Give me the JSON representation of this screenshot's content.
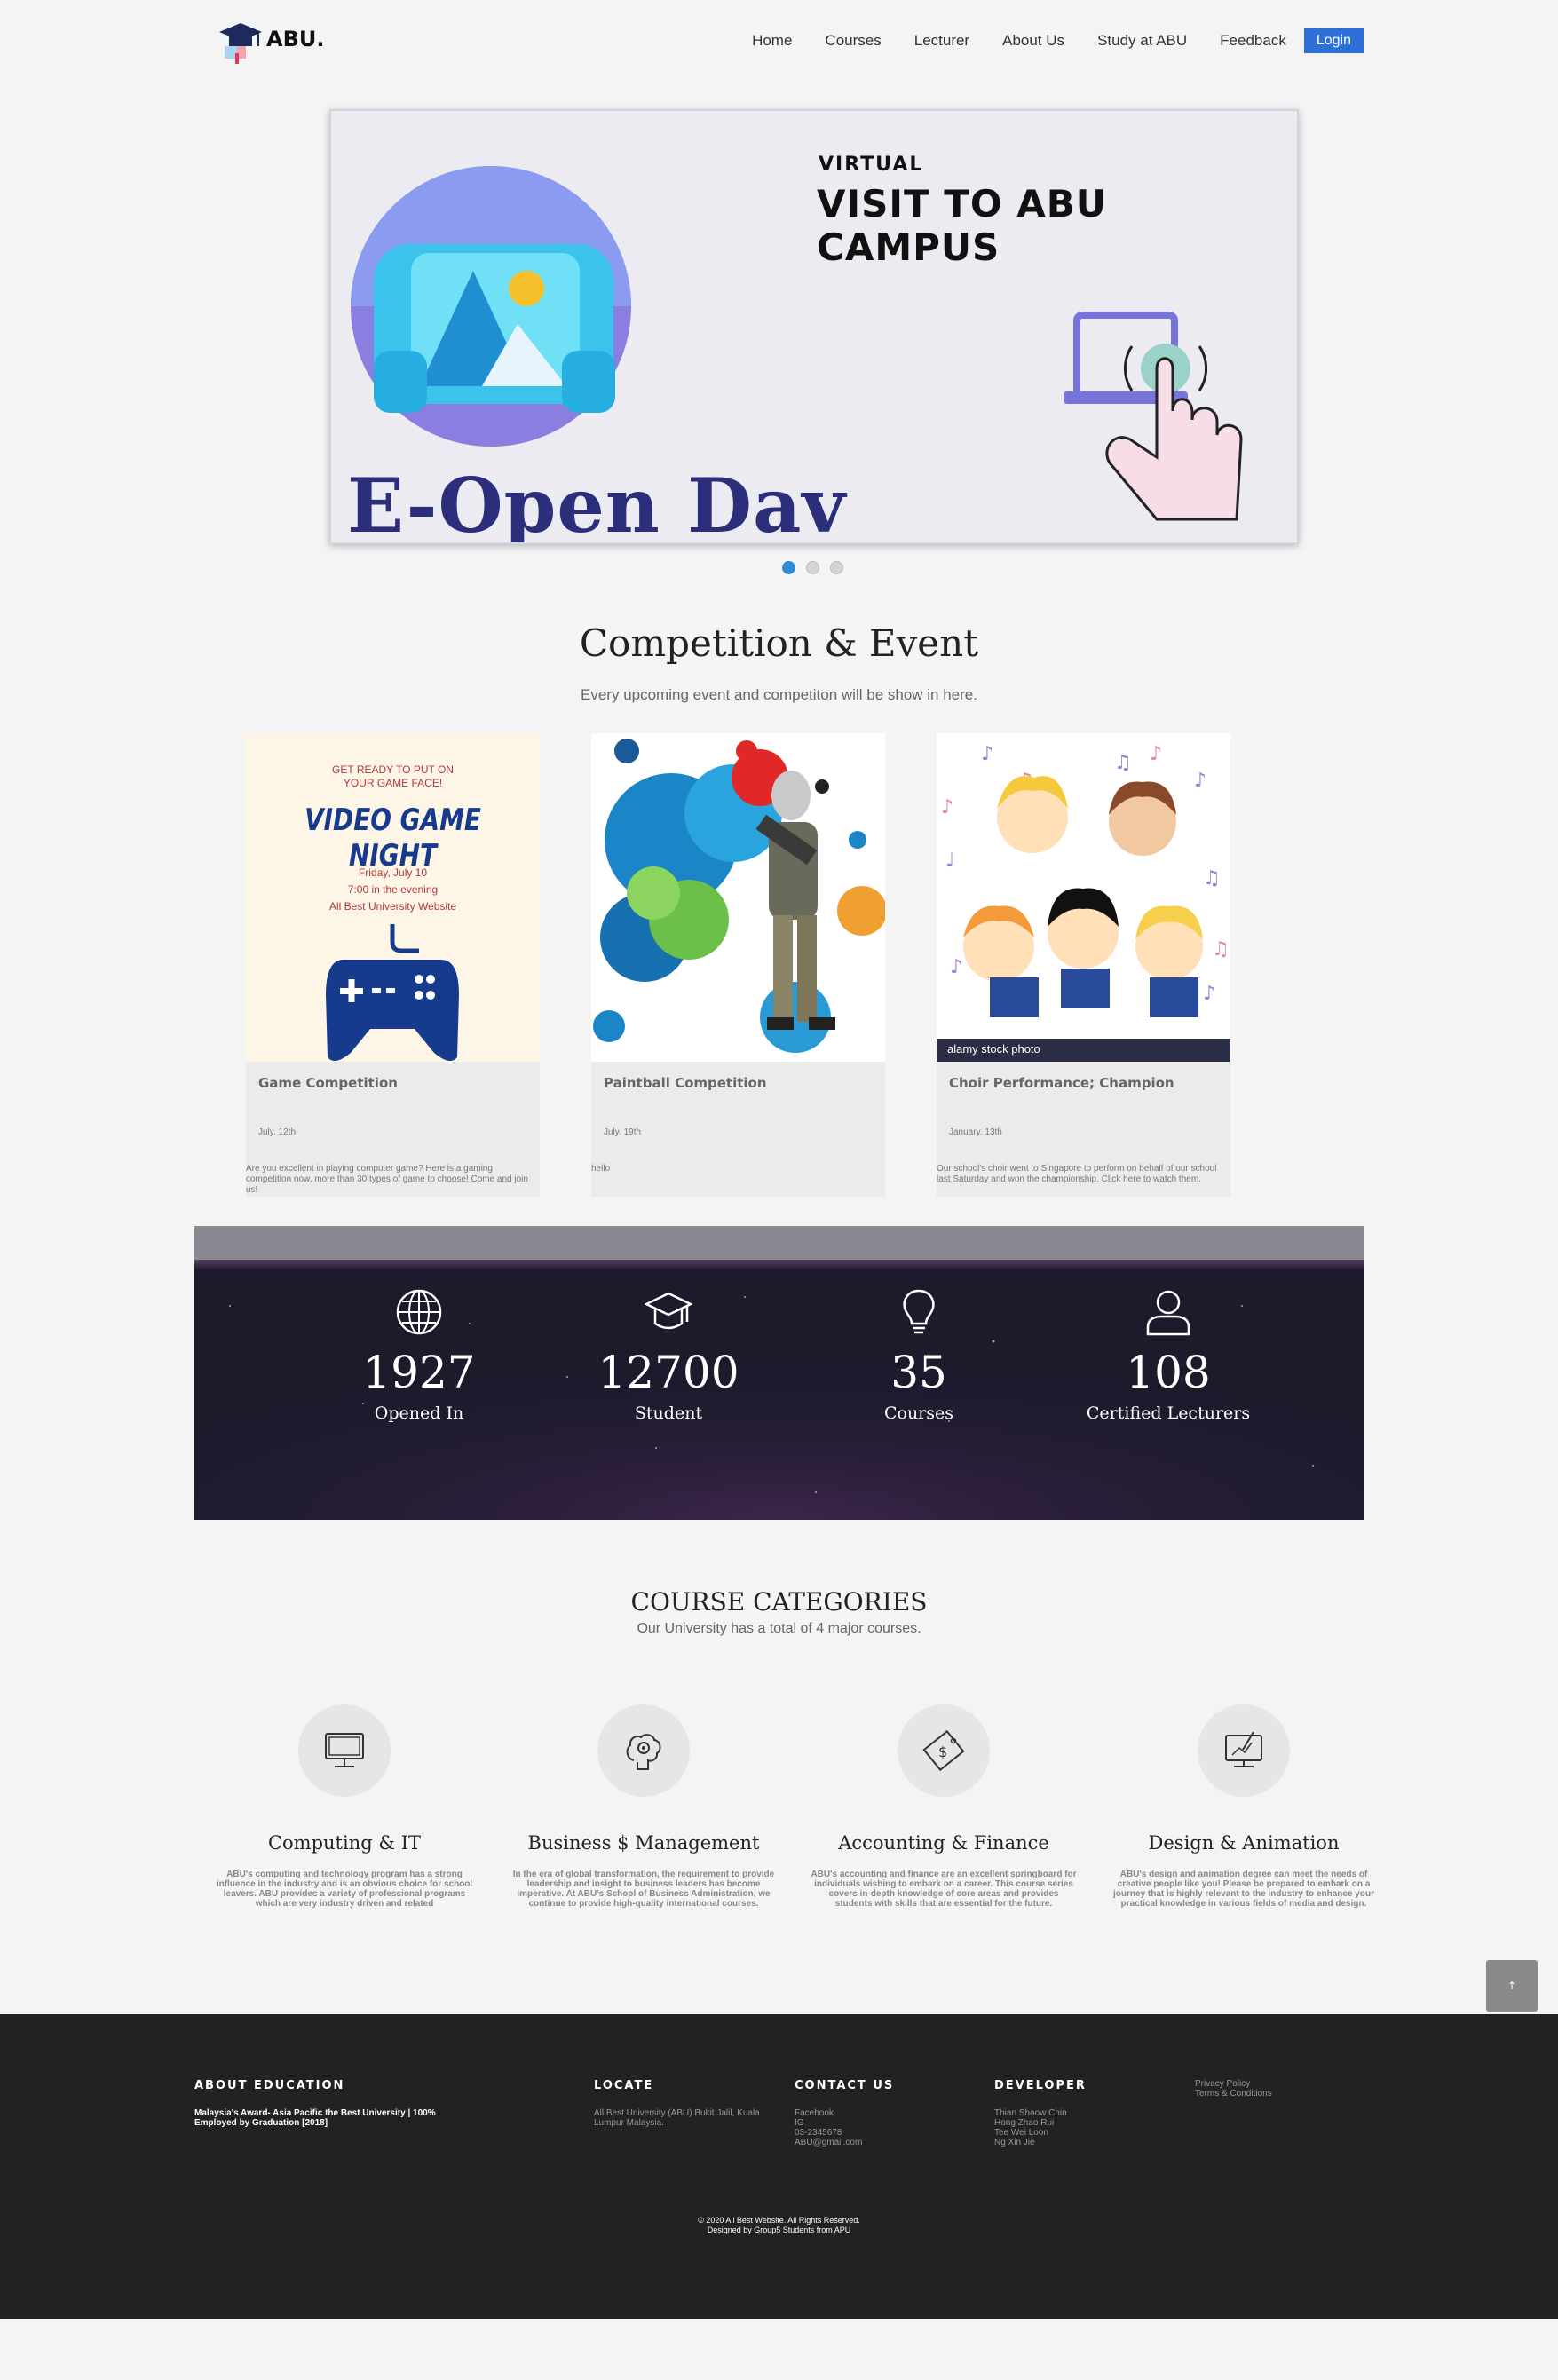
{
  "nav": {
    "brand": "ABU.",
    "items": [
      "Home",
      "Courses",
      "Lecturer",
      "About Us",
      "Study at ABU",
      "Feedback"
    ],
    "login": "Login"
  },
  "hero": {
    "eyebrow": "VIRTUAL",
    "title": "VISIT TO ABU CAMPUS",
    "banner": "E-Open Dav",
    "slides": 3,
    "active_slide": 1
  },
  "events": {
    "title": "Competition & Event",
    "subtitle": "Every upcoming event and competiton will be show in here.",
    "cards": [
      {
        "poster_top": "GET READY TO PUT ON\nYOUR GAME FACE!",
        "poster_title": "VIDEO GAME NIGHT",
        "poster_date": "Friday, July 10",
        "poster_time": "7:00 in the evening",
        "poster_place": "All Best University Website",
        "title": "Game Competition",
        "date": "July. 12th",
        "desc": "Are you excellent in playing computer game? Here is a gaming competition now, more than 30 types of game to choose! Come and join us!"
      },
      {
        "title": "Paintball Competition",
        "date": "July. 19th",
        "desc": "hello"
      },
      {
        "watermark": "alamy stock photo",
        "title": "Choir Performance; Champion",
        "date": "January. 13th",
        "desc": "Our school's choir went to Singapore to perform on behalf of our school last Saturday and won the championship. Click here to watch them."
      }
    ]
  },
  "stats": [
    {
      "icon": "globe-icon",
      "value": "1927",
      "label": "Opened In"
    },
    {
      "icon": "graduation-cap-icon",
      "value": "12700",
      "label": "Student"
    },
    {
      "icon": "lightbulb-icon",
      "value": "35",
      "label": "Courses"
    },
    {
      "icon": "user-icon",
      "value": "108",
      "label": "Certified Lecturers"
    }
  ],
  "courses": {
    "title": "COURSE CATEGORIES",
    "subtitle": "Our University has a total of 4 major courses.",
    "items": [
      {
        "icon": "monitor-icon",
        "name": "Computing & IT",
        "desc": "ABU's computing and technology program has a strong influence in the industry and is an obvious choice for school leavers. ABU provides a variety of professional programs which are very industry driven and related"
      },
      {
        "icon": "brain-gear-icon",
        "name": "Business $ Management",
        "desc": "In the era of global transformation, the requirement to provide leadership and insight to business leaders has become imperative. At ABU's School of Business Administration, we continue to provide high-quality international courses."
      },
      {
        "icon": "money-tag-icon",
        "name": "Accounting & Finance",
        "desc": "ABU's accounting and finance are an excellent springboard for individuals wishing to embark on a career. This course series covers in-depth knowledge of core areas and provides students with skills that are essential for the future."
      },
      {
        "icon": "design-monitor-icon",
        "name": "Design & Animation",
        "desc": "ABU's design and animation degree can meet the needs of creative people like you! Please be prepared to embark on a journey that is highly relevant to the industry to enhance your practical knowledge in various fields of media and design."
      }
    ]
  },
  "back_to_top": "↑",
  "footer": {
    "about": {
      "heading": "ABOUT EDUCATION",
      "text": "Malaysia's Award- Asia Pacific the Best University | 100% Employed by Graduation [2018]"
    },
    "locate": {
      "heading": "LOCATE",
      "text": "All Best University (ABU) Bukit Jalil, Kuala Lumpur Malaysia."
    },
    "contact": {
      "heading": "CONTACT US",
      "lines": [
        "Facebook",
        "IG",
        "03-2345678",
        "ABU@gmail.com"
      ]
    },
    "developer": {
      "heading": "DEVELOPER",
      "lines": [
        "Thian Shaow Chin",
        "Hong Zhao Rui",
        "Tee Wei Loon",
        "Ng Xin Jie"
      ]
    },
    "links": [
      "Privacy Policy",
      "Terms & Conditions"
    ],
    "copyright": "© 2020 All Best Website. All Rights Reserved.",
    "designed": "Designed by Group5 Students from APU"
  },
  "colors": {
    "accent": "#2f6fd8",
    "footer_bg": "#222222",
    "stats_bg": "#1d1a2c",
    "banner_text": "#2b2f7b",
    "poster_title": "#163a8c"
  }
}
